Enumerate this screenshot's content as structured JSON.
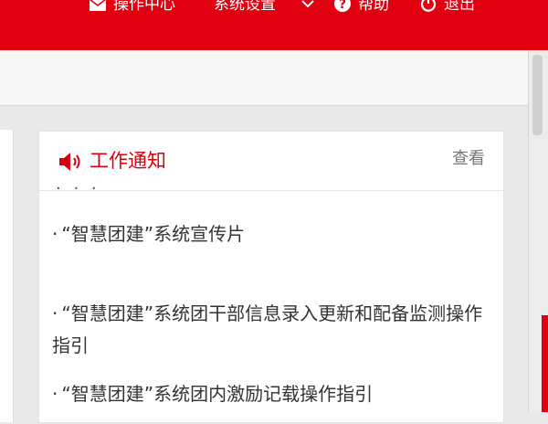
{
  "header": {
    "nav": [
      {
        "id": "ops-center",
        "label": "操作中心",
        "icon": "envelope-icon"
      },
      {
        "id": "settings",
        "label": "系统设置",
        "icon": "chevron-down-icon"
      },
      {
        "id": "help",
        "label": "帮助",
        "icon": "question-circle-icon"
      },
      {
        "id": "logout",
        "label": "退出",
        "icon": "power-icon"
      }
    ]
  },
  "notice_card": {
    "icon": "speaker-icon",
    "title": "工作通知",
    "view_label": "查看",
    "items": [
      {
        "bullet": "·",
        "text": "“智慧团建”系统宣传片"
      },
      {
        "bullet": "·",
        "text": "“智慧团建”系统团干部信息录入更新和配备监测操作指引"
      },
      {
        "bullet": "·",
        "text": "“智慧团建”系统团内激励记载操作指引"
      }
    ]
  },
  "colors": {
    "brand_red": "#e0000f",
    "title_red": "#d7000f",
    "text": "#333333",
    "muted": "#777777"
  }
}
